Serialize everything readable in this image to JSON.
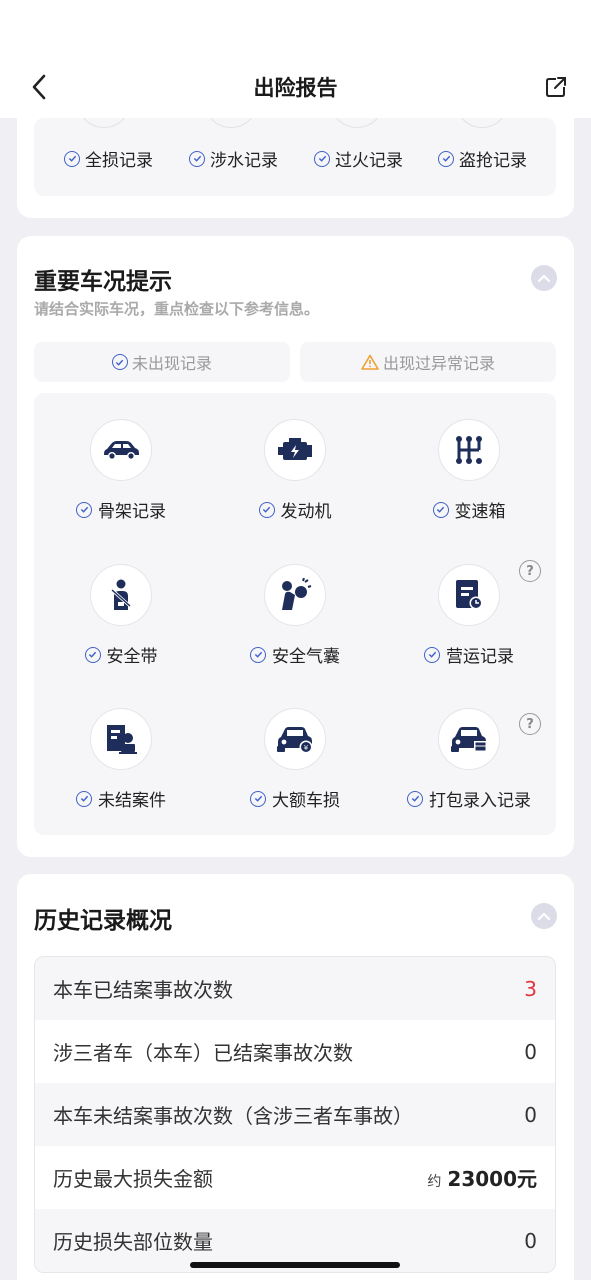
{
  "nav": {
    "title": "出险报告"
  },
  "top_records": [
    "全损记录",
    "涉水记录",
    "过火记录",
    "盗抢记录"
  ],
  "important": {
    "title": "重要车况提示",
    "subtitle": "请结合实际车况，重点检查以下参考信息。",
    "legend_normal": "未出现记录",
    "legend_abnormal": "出现过异常记录",
    "items": [
      {
        "label": "骨架记录",
        "icon": "car-frame-icon"
      },
      {
        "label": "发动机",
        "icon": "engine-icon"
      },
      {
        "label": "变速箱",
        "icon": "gearbox-icon"
      },
      {
        "label": "安全带",
        "icon": "seatbelt-icon"
      },
      {
        "label": "安全气囊",
        "icon": "airbag-icon"
      },
      {
        "label": "营运记录",
        "icon": "operation-record-icon"
      },
      {
        "label": "未结案件",
        "icon": "pending-case-icon"
      },
      {
        "label": "大额车损",
        "icon": "major-damage-icon"
      },
      {
        "label": "打包录入记录",
        "icon": "bundle-record-icon"
      }
    ]
  },
  "history": {
    "title": "历史记录概况",
    "rows": [
      {
        "label": "本车已结案事故次数",
        "value": "3"
      },
      {
        "label": "涉三者车（本车）已结案事故次数",
        "value": "0"
      },
      {
        "label": "本车未结案事故次数（含涉三者车事故）",
        "value": "0"
      },
      {
        "label": "历史最大损失金额",
        "prefix": "约",
        "value": "23000元"
      },
      {
        "label": "历史损失部位数量",
        "value": "0"
      }
    ]
  },
  "colors": {
    "accent": "#3e62c8",
    "warn": "#f0a030",
    "alert": "#e0343f",
    "icon_dark": "#1f2d5a"
  }
}
